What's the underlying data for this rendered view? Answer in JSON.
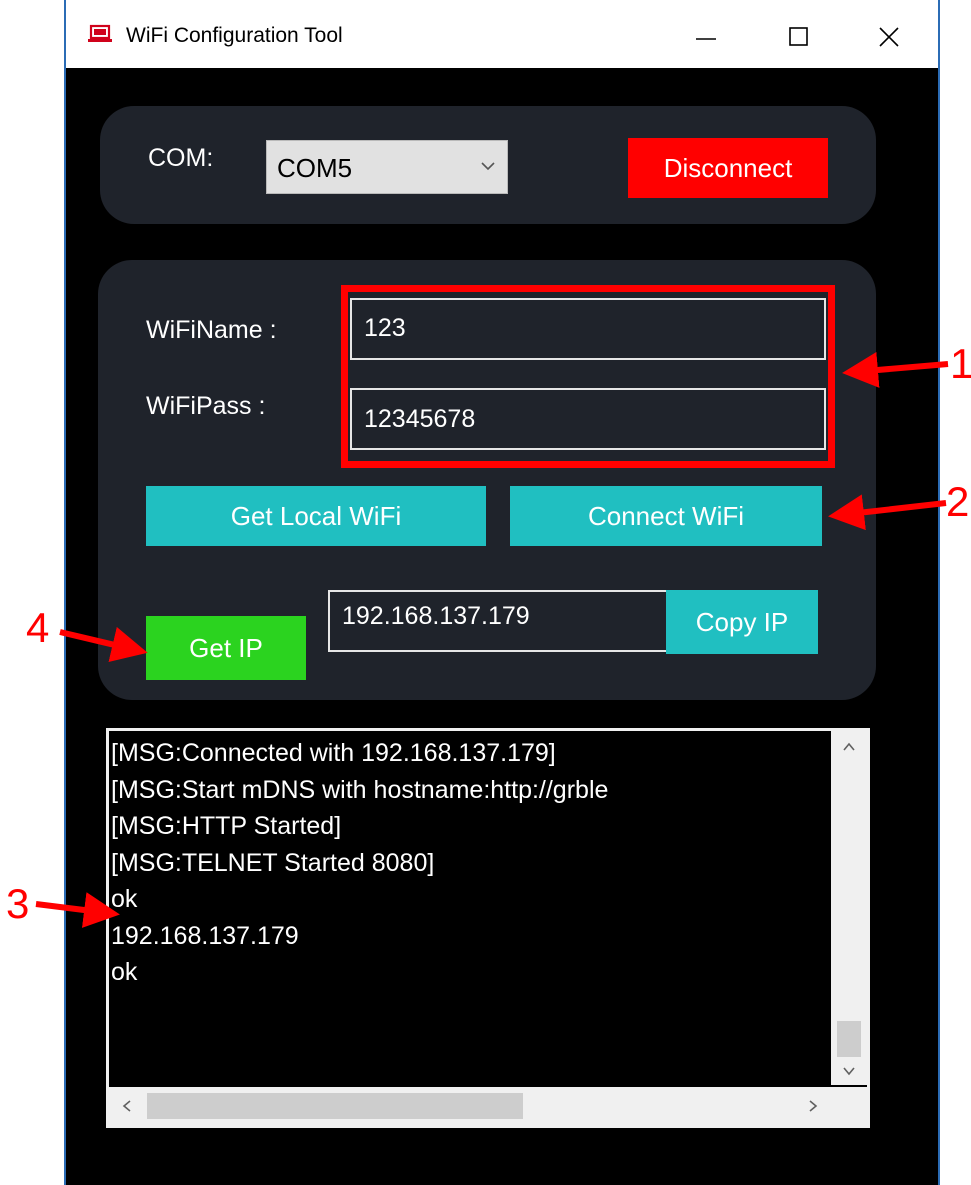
{
  "window": {
    "title": "WiFi Configuration Tool",
    "controls": {
      "minimize": "minimize",
      "maximize": "maximize",
      "close": "close"
    }
  },
  "com": {
    "label": "COM:",
    "selected": "COM5",
    "disconnect_label": "Disconnect"
  },
  "wifi": {
    "name_label": "WiFiName :",
    "name_value": "123",
    "pass_label": "WiFiPass :",
    "pass_value": "12345678",
    "get_local_label": "Get Local WiFi",
    "connect_label": "Connect WiFi"
  },
  "ip": {
    "get_ip_label": "Get IP",
    "value": "192.168.137.179",
    "copy_label": "Copy IP"
  },
  "log": {
    "lines": [
      "[MSG:Connected with 192.168.137.179]",
      "[MSG:Start mDNS with hostname:http://grble",
      "[MSG:HTTP Started]",
      "[MSG:TELNET Started 8080]",
      "ok",
      "192.168.137.179",
      "ok"
    ]
  },
  "annotations": {
    "callouts": [
      "1",
      "2",
      "3",
      "4"
    ],
    "color": "#ff0000"
  },
  "colors": {
    "panel": "#1f232b",
    "disconnect": "#ff0000",
    "cyan_button": "#20bfc1",
    "green_button": "#2bd31f"
  }
}
